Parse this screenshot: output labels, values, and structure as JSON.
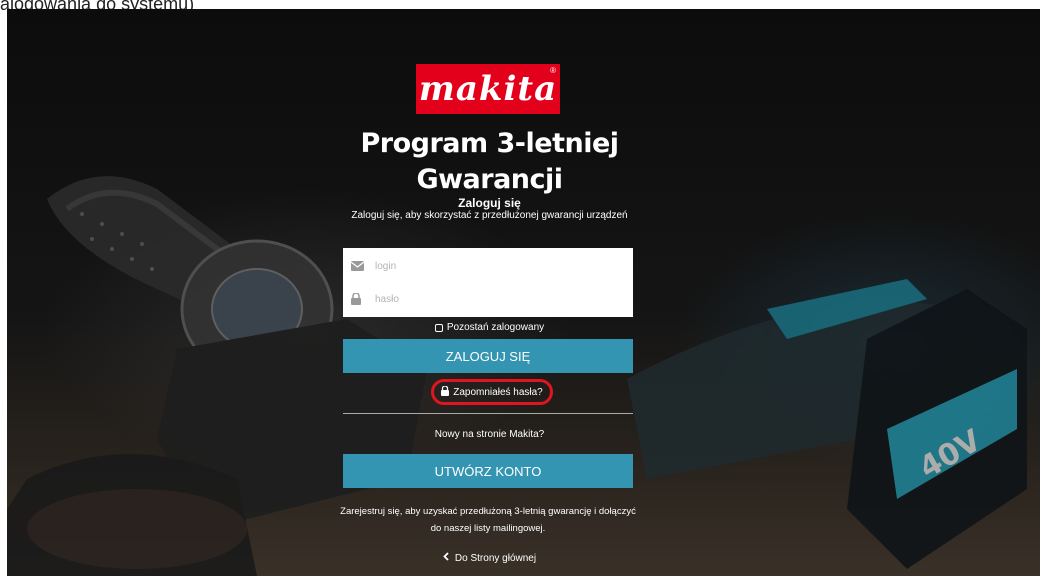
{
  "page": {
    "caption": "alogowania do systemu)"
  },
  "brand": {
    "logo_text": "makita",
    "logo_color": "#e2001a"
  },
  "header": {
    "title_line1": "Program 3-letniej",
    "title_line2": "Gwarancji",
    "subtitle": "Zaloguj się",
    "description": "Zaloguj się, aby skorzystać z przedłużonej gwarancji urządzeń"
  },
  "form": {
    "login_placeholder": "login",
    "login_icon": "envelope-icon",
    "password_placeholder": "hasło",
    "password_icon": "lock-icon",
    "remember_label": "Pozostań zalogowany",
    "login_button": "ZALOGUJ SIĘ",
    "forgot_label": "Zapomniałeś hasła?"
  },
  "register": {
    "prompt": "Nowy na stronie Makita?",
    "button": "UTWÓRZ KONTO",
    "info_line1": "Zarejestruj się, aby uzyskać przedłużoną 3-letnią gwarancję i dołączyć",
    "info_line2": "do naszej listy mailingowej."
  },
  "footer": {
    "back_label": "Do Strony głównej"
  },
  "colors": {
    "button": "#3395b1",
    "highlight": "#e0151f"
  }
}
